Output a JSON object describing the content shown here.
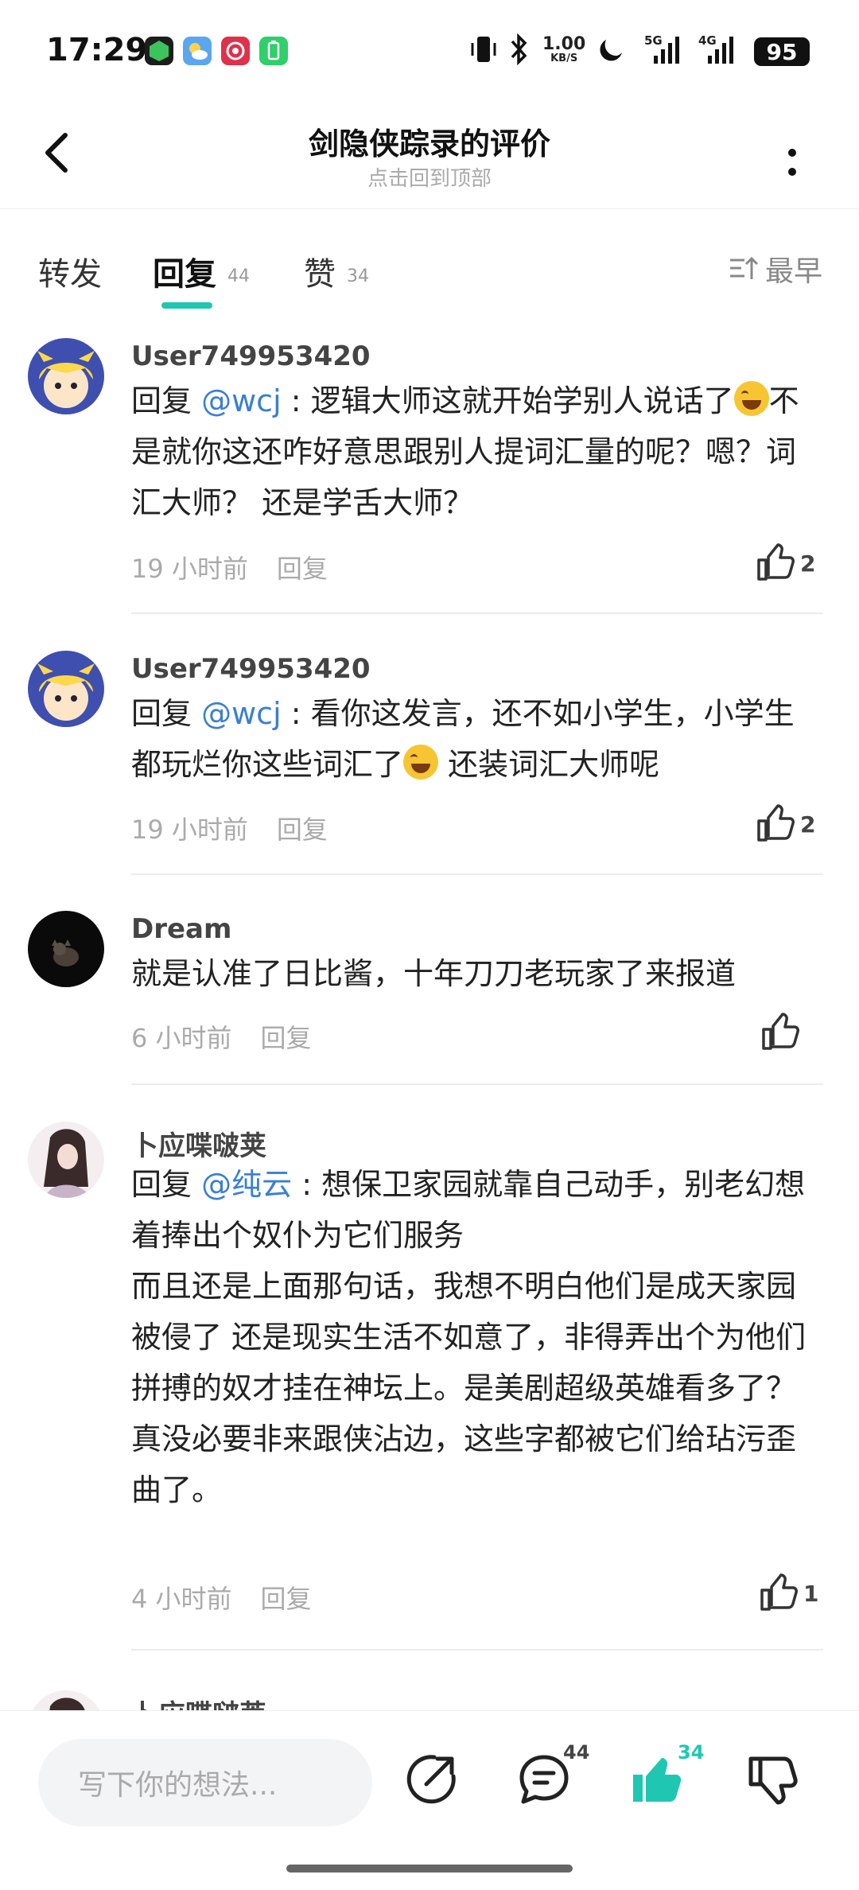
{
  "status": {
    "time": "17:29",
    "net_speed_top": "1.00",
    "net_speed_bottom": "KB/S",
    "sig1": "5G",
    "sig2": "4G",
    "battery": "95"
  },
  "header": {
    "title": "剑隐侠踪录的评价",
    "subtitle": "点击回到顶部"
  },
  "tabs": {
    "repost": "转发",
    "reply": "回复",
    "reply_count": "44",
    "like": "赞",
    "like_count": "34",
    "sort": "最早"
  },
  "comments": [
    {
      "user": "User749953420",
      "reply_prefix": "回复 ",
      "mention": "@wcj",
      "text_a": " : 逻辑大师这就开始学别人说话了",
      "text_b": "不是就你这还咋好意思跟别人提词汇量的呢？嗯？词汇大师？ 还是学舌大师？",
      "time": "19 小时前",
      "reply": "回复",
      "likes": "2"
    },
    {
      "user": "User749953420",
      "reply_prefix": "回复 ",
      "mention": "@wcj",
      "text_a": " : 看你这发言，还不如小学生，小学生都玩烂你这些词汇了",
      "text_b": " 还装词汇大师呢",
      "time": "19 小时前",
      "reply": "回复",
      "likes": "2"
    },
    {
      "user": "Dream",
      "text": "就是认准了日比酱，十年刀刀老玩家了来报道",
      "time": "6 小时前",
      "reply": "回复"
    },
    {
      "user": "卜应喋啵荚",
      "reply_prefix": "回复 ",
      "mention": "@纯云",
      "text_a": " : 想保卫家园就靠自己动手，别老幻想着捧出个奴仆为它们服务",
      "text_b": "而且还是上面那句话，我想不明白他们是成天家园被侵了 还是现实生活不如意了，非得弄出个为他们拼搏的奴才挂在神坛上。是美剧超级英雄看多了？",
      "text_c": "真没必要非来跟侠沾边，这些字都被它们给玷污歪曲了。",
      "time": "4 小时前",
      "reply": "回复",
      "likes": "1"
    },
    {
      "user": "卜应喋啵荚"
    }
  ],
  "bottom": {
    "placeholder": "写下你的想法...",
    "comment_count": "44",
    "like_count": "34"
  },
  "colors": {
    "accent": "#1fc7b2",
    "mention": "#3a7fd2"
  }
}
